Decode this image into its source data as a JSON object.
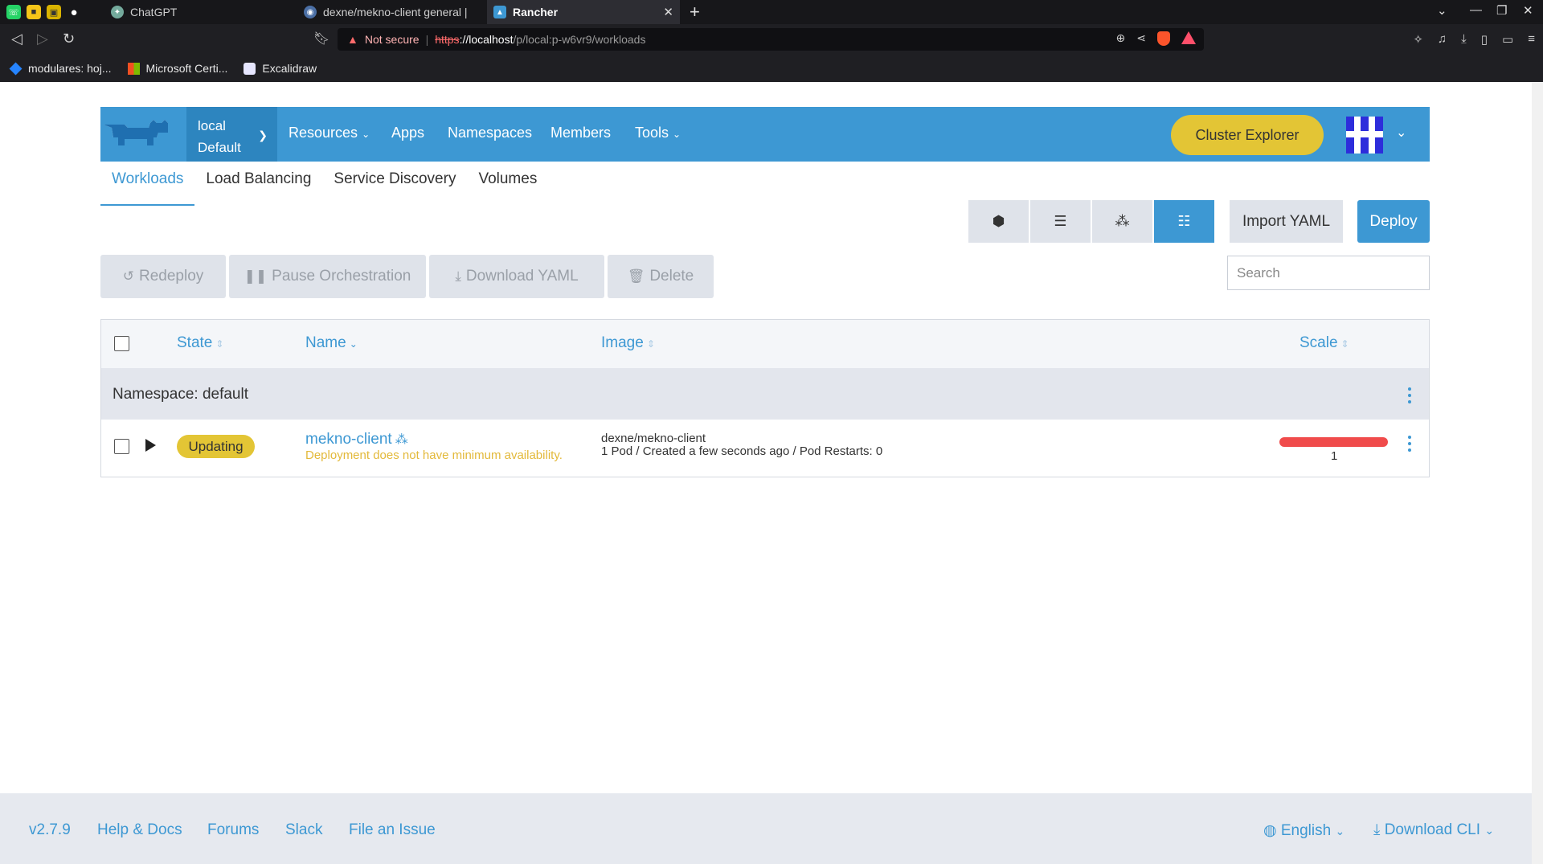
{
  "browser": {
    "tabs": [
      {
        "title": "ChatGPT"
      },
      {
        "title": "dexne/mekno-client general | "
      },
      {
        "title": "Rancher"
      }
    ],
    "url": {
      "not_secure": "Not secure",
      "scheme": "https",
      "host": "://localhost",
      "path": "/p/local:p-w6vr9/workloads"
    },
    "bookmarks": [
      {
        "label": "modulares: hoj..."
      },
      {
        "label": "Microsoft Certi..."
      },
      {
        "label": "Excalidraw"
      }
    ]
  },
  "header": {
    "cluster_name": "local",
    "project_name": "Default",
    "nav": [
      {
        "label": "Resources",
        "dropdown": true
      },
      {
        "label": "Apps"
      },
      {
        "label": "Namespaces"
      },
      {
        "label": "Members"
      },
      {
        "label": "Tools",
        "dropdown": true
      }
    ],
    "explorer_button": "Cluster Explorer"
  },
  "subtabs": [
    {
      "label": "Workloads",
      "active": true
    },
    {
      "label": "Load Balancing"
    },
    {
      "label": "Service Discovery"
    },
    {
      "label": "Volumes"
    }
  ],
  "toolbar": {
    "import_yaml": "Import YAML",
    "deploy": "Deploy",
    "view_icons": [
      "cube-icon",
      "server-icon",
      "nodes-icon",
      "list-icon"
    ]
  },
  "actions": {
    "redeploy": "Redeploy",
    "pause": "Pause Orchestration",
    "download": "Download YAML",
    "delete": "Delete"
  },
  "search": {
    "placeholder": "Search"
  },
  "table": {
    "columns": [
      "State",
      "Name",
      "Image",
      "Scale"
    ],
    "group_label": "Namespace: default",
    "rows": [
      {
        "state": "Updating",
        "name": "mekno-client",
        "message": "Deployment does not have minimum availability.",
        "image": "dexne/mekno-client",
        "image_info": "1 Pod / Created a few seconds ago / Pod Restarts: 0",
        "scale": "1"
      }
    ]
  },
  "footer": {
    "version": "v2.7.9",
    "help": "Help & Docs",
    "forums": "Forums",
    "slack": "Slack",
    "issue": "File an Issue",
    "language": "English",
    "download_cli": "Download CLI"
  },
  "colors": {
    "primary": "#3d98d3",
    "accent_yellow": "#e3c535",
    "error_red": "#f04b4b"
  }
}
